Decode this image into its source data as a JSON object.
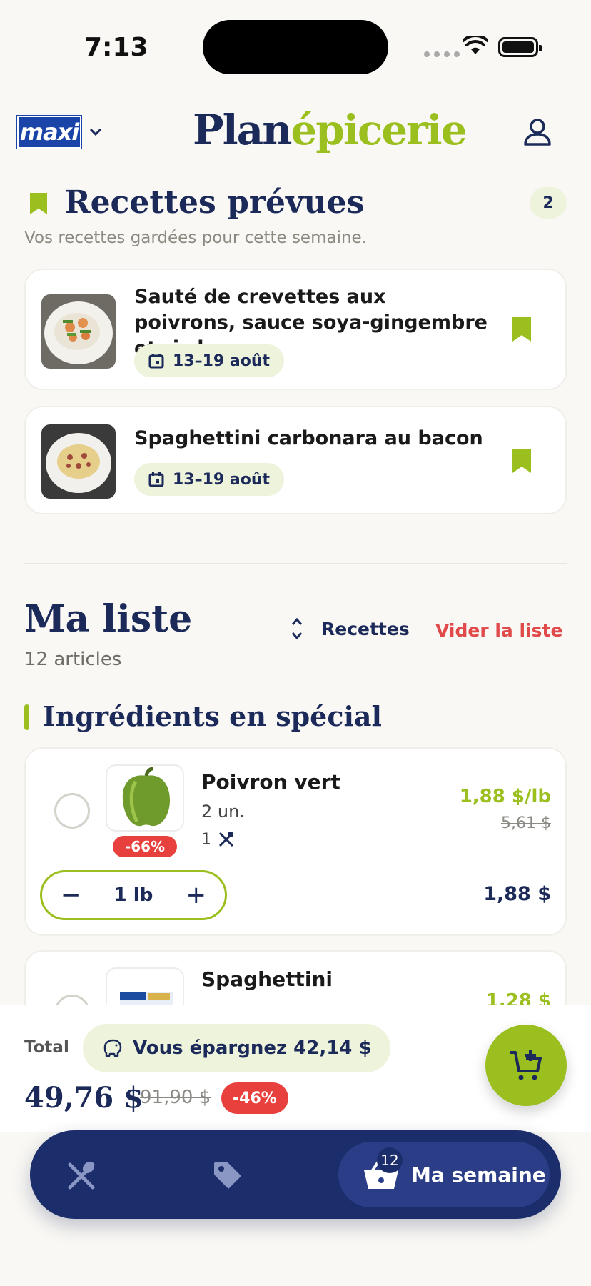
{
  "status": {
    "time": "7:13"
  },
  "header": {
    "store_logo": "maxi",
    "app_logo_part1": "Plan",
    "app_logo_part2": "épicerie"
  },
  "planned": {
    "title": "Recettes prévues",
    "count": "2",
    "subtitle": "Vos recettes gardées pour cette semaine.",
    "recipes": [
      {
        "title": "Sauté de crevettes aux poivrons, sauce soya-gingembre et riz bas…",
        "date": "13–19 août"
      },
      {
        "title": "Spaghettini carbonara au bacon",
        "date": "13–19 août"
      }
    ]
  },
  "list": {
    "title": "Ma liste",
    "count": "12 articles",
    "sort_label": "Recettes",
    "clear_label": "Vider la liste",
    "section_title": "Ingrédients en spécial",
    "items": [
      {
        "name": "Poivron vert",
        "qty": "2 un.",
        "recipes": "1",
        "discount": "-66%",
        "unit_price": "1,88 $/lb",
        "old_price": "5,61 $",
        "stepper_value": "1 lb",
        "total": "1,88 $"
      },
      {
        "name": "Spaghettini",
        "unit_price": "1,28 $"
      }
    ]
  },
  "totals": {
    "label": "Total",
    "savings": "Vous épargnez 42,14 $",
    "price": "49,76 $",
    "old_price": "91,90 $",
    "discount": "-46%"
  },
  "tabbar": {
    "active_label": "Ma semaine",
    "basket_count": "12"
  },
  "colors": {
    "navy": "#1c2a5a",
    "green": "#9bbf1e",
    "red": "#e8413d",
    "background": "#f9f8f4"
  }
}
